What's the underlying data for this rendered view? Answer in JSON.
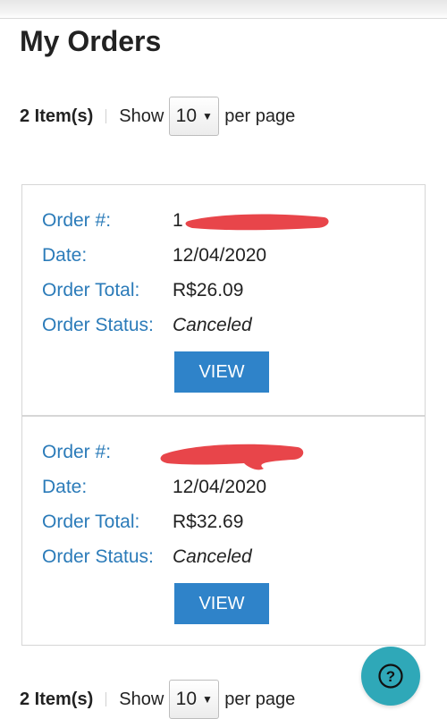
{
  "page_title": "My Orders",
  "pager_top": {
    "count": "2 Item(s)",
    "show_label": "Show",
    "per_page_value": "10",
    "per_page_label": "per page"
  },
  "pager_bottom": {
    "count": "2 Item(s)",
    "show_label": "Show",
    "per_page_value": "10",
    "per_page_label": "per page"
  },
  "orders": [
    {
      "order_label": "Order #:",
      "order_value": "1",
      "date_label": "Date:",
      "date_value": "12/04/2020",
      "total_label": "Order Total:",
      "total_value": "R$26.09",
      "status_label": "Order Status:",
      "status_value": "Canceled",
      "view_label": "VIEW"
    },
    {
      "order_label": "Order #:",
      "order_value": "",
      "date_label": "Date:",
      "date_value": "12/04/2020",
      "total_label": "Order Total:",
      "total_value": "R$32.69",
      "status_label": "Order Status:",
      "status_value": "Canceled",
      "view_label": "VIEW"
    }
  ],
  "help_button": {
    "icon": "question-icon",
    "label": "?"
  },
  "colors": {
    "label_blue": "#2b7bb9",
    "button_blue": "#2f83c9",
    "help_teal": "#2fa8b8",
    "redaction_red": "#e8454a"
  }
}
